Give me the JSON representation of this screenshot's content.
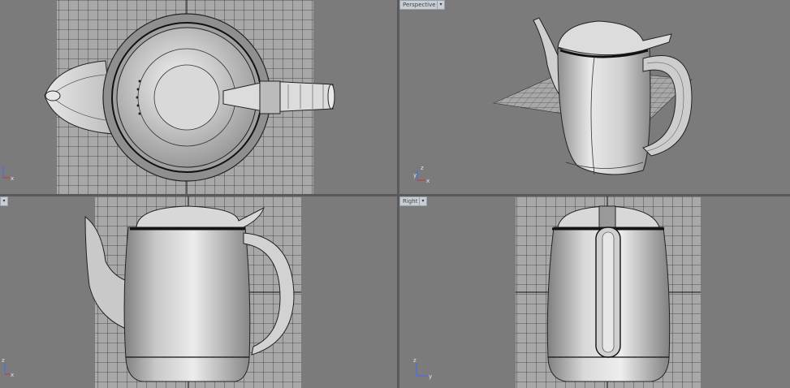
{
  "viewports": {
    "top": {
      "label": ""
    },
    "perspective": {
      "label": "Perspective"
    },
    "front": {
      "label": ""
    },
    "right": {
      "label": "Right"
    }
  },
  "dropdown_glyph": "▾",
  "axis": {
    "x": "x",
    "y": "y",
    "z": "z"
  },
  "colors": {
    "background": "#7b7b7b",
    "grid": "#2f2f2f",
    "grid_fill": "#a3a3a3",
    "divider": "#dcdcdc"
  }
}
